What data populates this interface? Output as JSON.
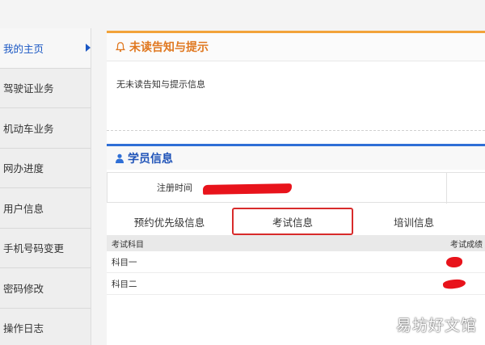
{
  "sidebar": {
    "items": [
      {
        "label": "我的主页",
        "active": true
      },
      {
        "label": "驾驶证业务"
      },
      {
        "label": "机动车业务"
      },
      {
        "label": "网办进度"
      },
      {
        "label": "用户信息"
      },
      {
        "label": "手机号码变更"
      },
      {
        "label": "密码修改"
      },
      {
        "label": "操作日志"
      }
    ]
  },
  "notice": {
    "title": "未读告知与提示",
    "text": "无未读告知与提示信息",
    "icon": "bell-icon"
  },
  "student": {
    "title": "学员信息",
    "icon": "person-icon",
    "reg_label": "注册时间"
  },
  "tabs": [
    {
      "label": "预约优先级信息"
    },
    {
      "label": "考试信息",
      "highlighted": true
    },
    {
      "label": "培训信息"
    }
  ],
  "exam_table": {
    "headers": [
      "考试科目",
      "考试成绩"
    ],
    "rows": [
      {
        "subject": "科目一"
      },
      {
        "subject": "科目二"
      }
    ]
  },
  "watermark": "易坊好文馆",
  "colors": {
    "accent_blue": "#1f53b8",
    "accent_orange": "#e07820",
    "highlight_red": "#d82b2b",
    "redaction_red": "#e8131b"
  }
}
